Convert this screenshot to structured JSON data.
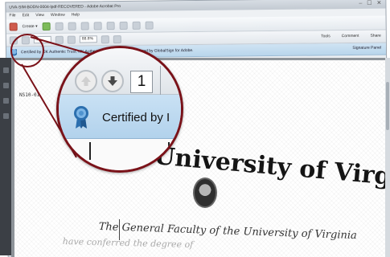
{
  "window": {
    "title": "UVA-SIM-BODN-0004-lpdf-RECOVERED - Adobe Acrobat Pro",
    "controls": "– ☐ ✕"
  },
  "menu": {
    "items": [
      "File",
      "Edit",
      "View",
      "Window",
      "Help"
    ]
  },
  "toolbar": {
    "create_label": "Create ▾"
  },
  "navbar": {
    "page_value": "1",
    "zoom_value": "88.8%",
    "tabs": [
      "Tools",
      "Comment",
      "Share"
    ]
  },
  "signature_bar": {
    "message": "Certified by IJK Authentic Trust, IJK Authentic Limited, certificate issued by GlobalSign for Adobe.",
    "panel_button": "Signature Panel"
  },
  "document": {
    "certificate_number": "NS10-01",
    "university_name": "University of Virginia",
    "line1": "The General Faculty of the University of Virginia",
    "line2": "have conferred the degree of"
  },
  "magnifier": {
    "page_value": "1",
    "certified_text": "Certified by I"
  },
  "colors": {
    "callout": "#7a1219",
    "signature_bar": "#b9d6ec",
    "ribbon": "#2c6fae"
  }
}
